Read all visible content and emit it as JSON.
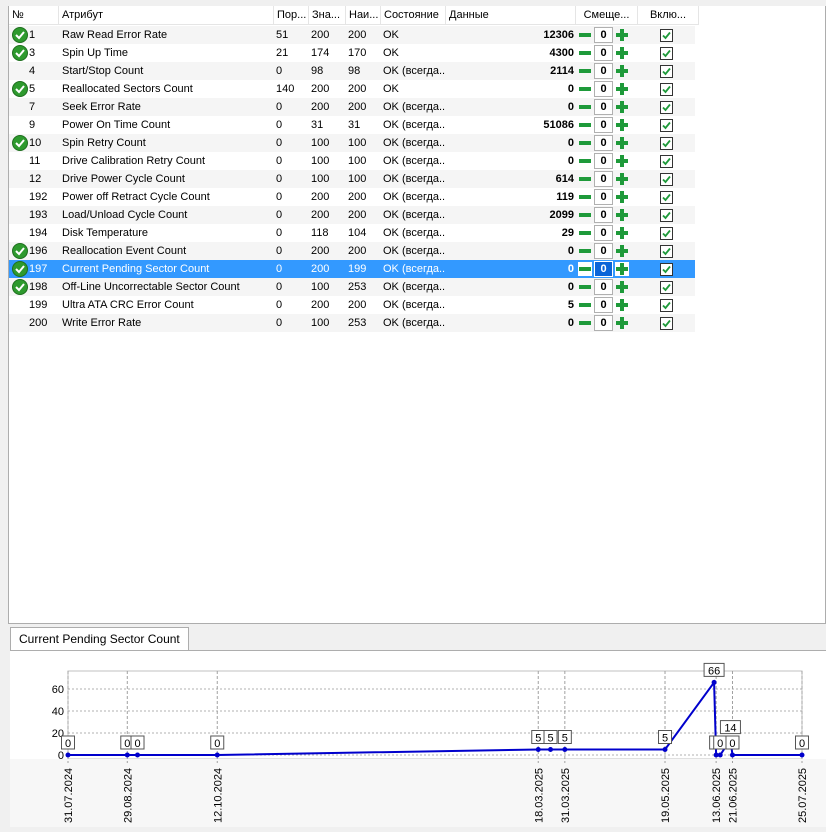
{
  "table": {
    "columns": [
      "№",
      "Атрибут",
      "Пор...",
      "Зна...",
      "Наи...",
      "Состояние",
      "Данные",
      "Смеще...",
      "Вклю..."
    ],
    "rows": [
      {
        "icon": "ok-icon",
        "id": "1",
        "name": "Raw Read Error Rate",
        "threshold": "51",
        "value": "200",
        "worst": "200",
        "state": "OK",
        "data": "12306",
        "offset": "0",
        "enabled": true
      },
      {
        "icon": "ok-icon",
        "id": "3",
        "name": "Spin Up Time",
        "threshold": "21",
        "value": "174",
        "worst": "170",
        "state": "OK",
        "data": "4300",
        "offset": "0",
        "enabled": true
      },
      {
        "icon": "",
        "id": "4",
        "name": "Start/Stop Count",
        "threshold": "0",
        "value": "98",
        "worst": "98",
        "state": "OK (всегда...",
        "data": "2114",
        "offset": "0",
        "enabled": true
      },
      {
        "icon": "ok-icon",
        "id": "5",
        "name": "Reallocated Sectors Count",
        "threshold": "140",
        "value": "200",
        "worst": "200",
        "state": "OK",
        "data": "0",
        "offset": "0",
        "enabled": true
      },
      {
        "icon": "",
        "id": "7",
        "name": "Seek Error Rate",
        "threshold": "0",
        "value": "200",
        "worst": "200",
        "state": "OK (всегда...",
        "data": "0",
        "offset": "0",
        "enabled": true
      },
      {
        "icon": "",
        "id": "9",
        "name": "Power On Time Count",
        "threshold": "0",
        "value": "31",
        "worst": "31",
        "state": "OK (всегда...",
        "data": "51086",
        "offset": "0",
        "enabled": true
      },
      {
        "icon": "ok-icon",
        "id": "10",
        "name": "Spin Retry Count",
        "threshold": "0",
        "value": "100",
        "worst": "100",
        "state": "OK (всегда...",
        "data": "0",
        "offset": "0",
        "enabled": true
      },
      {
        "icon": "",
        "id": "11",
        "name": "Drive Calibration Retry Count",
        "threshold": "0",
        "value": "100",
        "worst": "100",
        "state": "OK (всегда...",
        "data": "0",
        "offset": "0",
        "enabled": true
      },
      {
        "icon": "",
        "id": "12",
        "name": "Drive Power Cycle Count",
        "threshold": "0",
        "value": "100",
        "worst": "100",
        "state": "OK (всегда...",
        "data": "614",
        "offset": "0",
        "enabled": true
      },
      {
        "icon": "",
        "id": "192",
        "name": "Power off Retract Cycle Count",
        "threshold": "0",
        "value": "200",
        "worst": "200",
        "state": "OK (всегда...",
        "data": "119",
        "offset": "0",
        "enabled": true
      },
      {
        "icon": "",
        "id": "193",
        "name": "Load/Unload Cycle Count",
        "threshold": "0",
        "value": "200",
        "worst": "200",
        "state": "OK (всегда...",
        "data": "2099",
        "offset": "0",
        "enabled": true
      },
      {
        "icon": "",
        "id": "194",
        "name": "Disk Temperature",
        "threshold": "0",
        "value": "118",
        "worst": "104",
        "state": "OK (всегда...",
        "data": "29",
        "offset": "0",
        "enabled": true
      },
      {
        "icon": "ok-icon",
        "id": "196",
        "name": "Reallocation Event Count",
        "threshold": "0",
        "value": "200",
        "worst": "200",
        "state": "OK (всегда...",
        "data": "0",
        "offset": "0",
        "enabled": true
      },
      {
        "icon": "ok-icon",
        "id": "197",
        "name": "Current Pending Sector Count",
        "threshold": "0",
        "value": "200",
        "worst": "199",
        "state": "OK (всегда...",
        "data": "0",
        "offset": "0",
        "enabled": true,
        "selected": true
      },
      {
        "icon": "ok-icon",
        "id": "198",
        "name": "Off-Line Uncorrectable Sector Count",
        "threshold": "0",
        "value": "100",
        "worst": "253",
        "state": "OK (всегда...",
        "data": "0",
        "offset": "0",
        "enabled": true
      },
      {
        "icon": "",
        "id": "199",
        "name": "Ultra ATA CRC Error Count",
        "threshold": "0",
        "value": "200",
        "worst": "200",
        "state": "OK (всегда...",
        "data": "5",
        "offset": "0",
        "enabled": true
      },
      {
        "icon": "",
        "id": "200",
        "name": "Write Error Rate",
        "threshold": "0",
        "value": "100",
        "worst": "253",
        "state": "OK (всегда...",
        "data": "0",
        "offset": "0",
        "enabled": true
      }
    ]
  },
  "tab": {
    "label": "Current Pending Sector Count"
  },
  "colors": {
    "selection": "#3399ff",
    "ok_icon": "#2e9a2e",
    "line": "#0000cc",
    "buttons": "#1e9a3a"
  },
  "chart_data": {
    "type": "line",
    "ylim": [
      0,
      70
    ],
    "yticks": [
      "0",
      "20",
      "40",
      "60"
    ],
    "xticks": [
      "31.07.2024",
      "29.08.2024",
      "12.10.2024",
      "18.03.2025",
      "31.03.2025",
      "19.05.2025",
      "13.06.2025",
      "21.06.2025",
      "25.07.2025"
    ],
    "points": [
      {
        "x": "31.07.2024",
        "y": 0
      },
      {
        "x": "29.08.2024",
        "y": 0
      },
      {
        "x": "03.09.2024",
        "y": 0
      },
      {
        "x": "12.10.2024",
        "y": 0
      },
      {
        "x": "18.03.2025",
        "y": 5
      },
      {
        "x": "24.03.2025",
        "y": 5
      },
      {
        "x": "31.03.2025",
        "y": 5
      },
      {
        "x": "19.05.2025",
        "y": 5
      },
      {
        "x": "12.06.2025",
        "y": 66
      },
      {
        "x": "13.06.2025",
        "y": 0
      },
      {
        "x": "15.06.2025",
        "y": 0
      },
      {
        "x": "20.06.2025",
        "y": 14
      },
      {
        "x": "21.06.2025",
        "y": 0
      },
      {
        "x": "25.07.2025",
        "y": 0
      }
    ],
    "labeled_points": [
      {
        "x": "31.07.2024",
        "label": "0"
      },
      {
        "x": "29.08.2024",
        "label": "0"
      },
      {
        "x": "03.09.2024",
        "label": "0"
      },
      {
        "x": "12.10.2024",
        "label": "0"
      },
      {
        "x": "18.03.2025",
        "label": "5"
      },
      {
        "x": "24.03.2025",
        "label": "5"
      },
      {
        "x": "31.03.2025",
        "label": "5"
      },
      {
        "x": "19.05.2025",
        "label": "5"
      },
      {
        "x": "12.06.2025",
        "label": "66"
      },
      {
        "x": "13.06.2025",
        "label": "0"
      },
      {
        "x": "15.06.2025",
        "label": "0"
      },
      {
        "x": "20.06.2025",
        "label": "14"
      },
      {
        "x": "21.06.2025",
        "label": "0"
      },
      {
        "x": "25.07.2025",
        "label": "0"
      }
    ],
    "grid": true
  }
}
